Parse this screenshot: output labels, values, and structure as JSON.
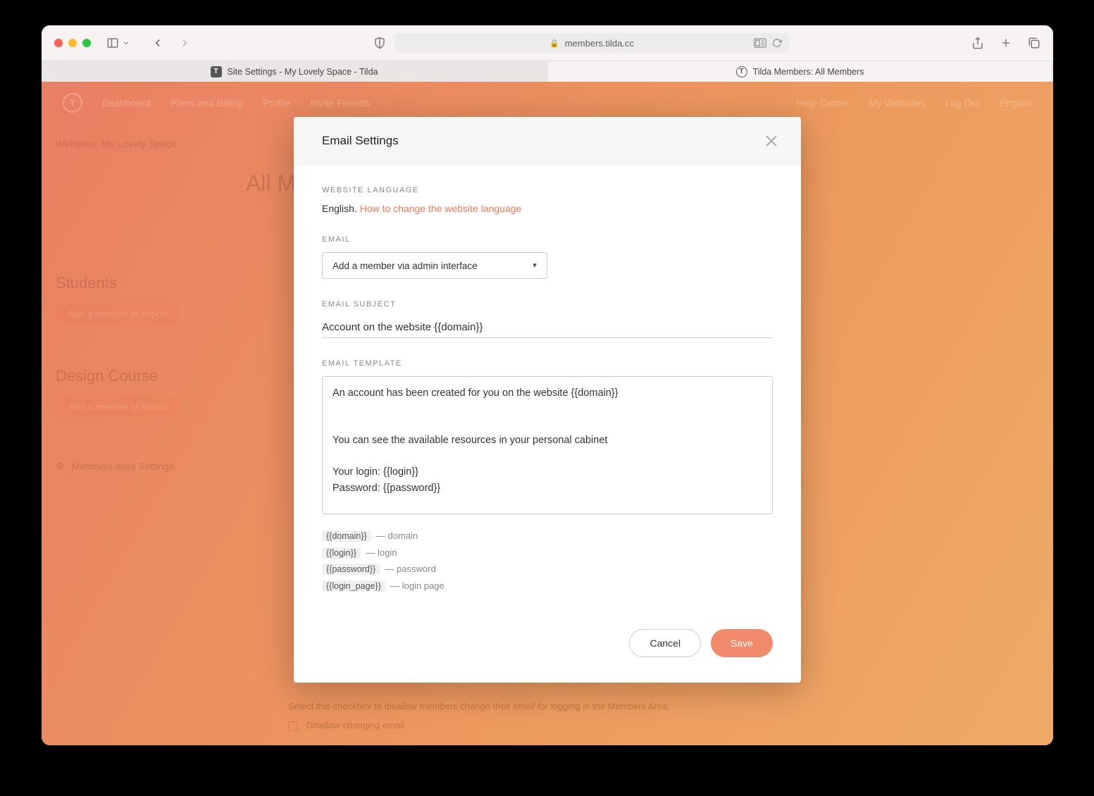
{
  "browser": {
    "address": "members.tilda.cc",
    "tabs": [
      {
        "label": "Site Settings - My Lovely Space - Tilda",
        "fav": "T"
      },
      {
        "label": "Tilda Members: All Members",
        "fav": "T"
      }
    ]
  },
  "background": {
    "nav": [
      "Dashboard",
      "Plans and Billing",
      "Profile",
      "Invite Friends"
    ],
    "nav_right": [
      "Help Center",
      "My Websites",
      "Log Out",
      "English"
    ],
    "crumb": "Websites: My Lovely Space",
    "title": "All Members",
    "section1": "Students",
    "pill1": "Add a member or import",
    "section2": "Design Course",
    "pill2": "Add a member or import",
    "settings": "Members Area Settings",
    "below_text": "Select this checkbox to disallow members change their email for logging in the Members Area.",
    "below_cb": "Disallow changing email"
  },
  "modal": {
    "title": "Email Settings",
    "labels": {
      "lang": "WEBSITE LANGUAGE",
      "email": "EMAIL",
      "subject": "EMAIL SUBJECT",
      "template": "EMAIL TEMPLATE"
    },
    "lang_value": "English.",
    "lang_link": "How to change the website language",
    "email_select": "Add a member via admin interface",
    "subject_value": "Account on the website {{domain}}",
    "template_value": "An account has been created for you on the website {{domain}}\n\n\nYou can see the available resources in your personal cabinet\n\nYour login: {{login}}\nPassword: {{password}}",
    "vars": [
      {
        "tag": "{{domain}}",
        "desc": "domain"
      },
      {
        "tag": "{{login}}",
        "desc": "login"
      },
      {
        "tag": "{{password}}",
        "desc": "password"
      },
      {
        "tag": "{{login_page}}",
        "desc": "login page"
      }
    ],
    "cancel": "Cancel",
    "save": "Save"
  }
}
